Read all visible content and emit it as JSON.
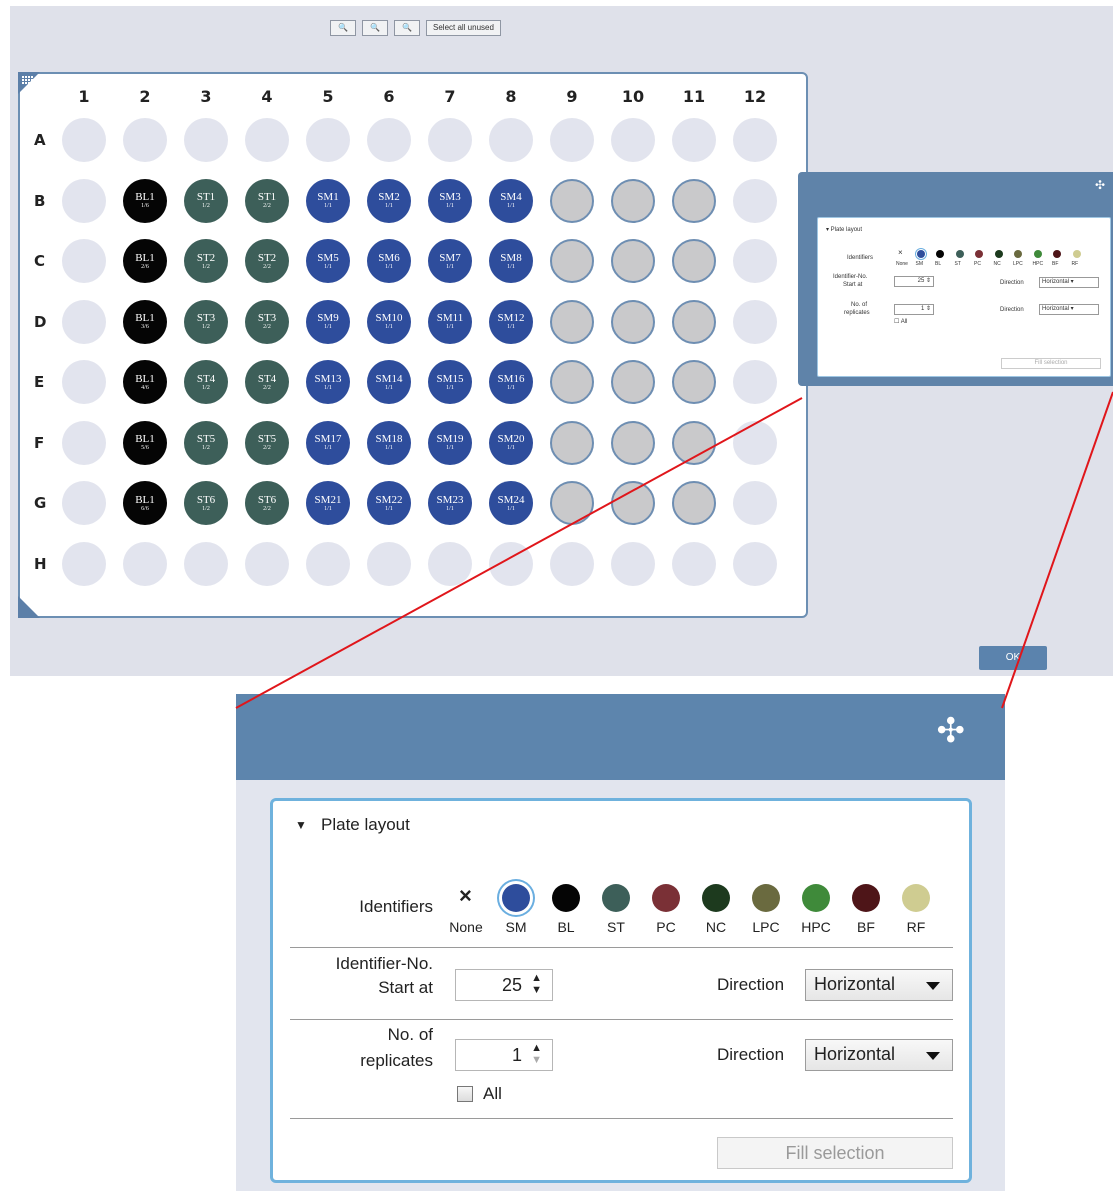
{
  "toolbar": {
    "zoom_in": "🔍",
    "zoom_reset": "🔍",
    "zoom_out": "🔍",
    "select_all_unused": "Select all unused"
  },
  "plate": {
    "icon": "grid-icon",
    "columns": [
      "1",
      "2",
      "3",
      "4",
      "5",
      "6",
      "7",
      "8",
      "9",
      "10",
      "11",
      "12"
    ],
    "rows": [
      "A",
      "B",
      "C",
      "D",
      "E",
      "F",
      "G",
      "H"
    ],
    "filled_wells": {
      "B": [
        [
          "bl",
          "BL1",
          "1/6"
        ],
        [
          "st",
          "ST1",
          "1/2"
        ],
        [
          "st",
          "ST1",
          "2/2"
        ],
        [
          "sm",
          "SM1",
          "1/1"
        ],
        [
          "sm",
          "SM2",
          "1/1"
        ],
        [
          "sm",
          "SM3",
          "1/1"
        ],
        [
          "sm",
          "SM4",
          "1/1"
        ]
      ],
      "C": [
        [
          "bl",
          "BL1",
          "2/6"
        ],
        [
          "st",
          "ST2",
          "1/2"
        ],
        [
          "st",
          "ST2",
          "2/2"
        ],
        [
          "sm",
          "SM5",
          "1/1"
        ],
        [
          "sm",
          "SM6",
          "1/1"
        ],
        [
          "sm",
          "SM7",
          "1/1"
        ],
        [
          "sm",
          "SM8",
          "1/1"
        ]
      ],
      "D": [
        [
          "bl",
          "BL1",
          "3/6"
        ],
        [
          "st",
          "ST3",
          "1/2"
        ],
        [
          "st",
          "ST3",
          "2/2"
        ],
        [
          "sm",
          "SM9",
          "1/1"
        ],
        [
          "sm",
          "SM10",
          "1/1"
        ],
        [
          "sm",
          "SM11",
          "1/1"
        ],
        [
          "sm",
          "SM12",
          "1/1"
        ]
      ],
      "E": [
        [
          "bl",
          "BL1",
          "4/6"
        ],
        [
          "st",
          "ST4",
          "1/2"
        ],
        [
          "st",
          "ST4",
          "2/2"
        ],
        [
          "sm",
          "SM13",
          "1/1"
        ],
        [
          "sm",
          "SM14",
          "1/1"
        ],
        [
          "sm",
          "SM15",
          "1/1"
        ],
        [
          "sm",
          "SM16",
          "1/1"
        ]
      ],
      "F": [
        [
          "bl",
          "BL1",
          "5/6"
        ],
        [
          "st",
          "ST5",
          "1/2"
        ],
        [
          "st",
          "ST5",
          "2/2"
        ],
        [
          "sm",
          "SM17",
          "1/1"
        ],
        [
          "sm",
          "SM18",
          "1/1"
        ],
        [
          "sm",
          "SM19",
          "1/1"
        ],
        [
          "sm",
          "SM20",
          "1/1"
        ]
      ],
      "G": [
        [
          "bl",
          "BL1",
          "6/6"
        ],
        [
          "st",
          "ST6",
          "1/2"
        ],
        [
          "st",
          "ST6",
          "2/2"
        ],
        [
          "sm",
          "SM21",
          "1/1"
        ],
        [
          "sm",
          "SM22",
          "1/1"
        ],
        [
          "sm",
          "SM23",
          "1/1"
        ],
        [
          "sm",
          "SM24",
          "1/1"
        ]
      ]
    },
    "selected_rows": [
      "B",
      "C",
      "D",
      "E",
      "F",
      "G"
    ],
    "selected_cols": [
      "9",
      "10",
      "11"
    ]
  },
  "ok_button": "OK",
  "panel": {
    "move_icon": "move-arrows-icon",
    "section_title": "Plate layout",
    "identifiers_label": "Identifiers",
    "identifiers": [
      {
        "key": "None",
        "color": "none"
      },
      {
        "key": "SM",
        "color": "#2e4d9c"
      },
      {
        "key": "BL",
        "color": "#050505"
      },
      {
        "key": "ST",
        "color": "#3d5f59"
      },
      {
        "key": "PC",
        "color": "#7a3036"
      },
      {
        "key": "NC",
        "color": "#1d3a1e"
      },
      {
        "key": "LPC",
        "color": "#6a6a3f"
      },
      {
        "key": "HPC",
        "color": "#3f8a3a"
      },
      {
        "key": "BF",
        "color": "#4e1518"
      },
      {
        "key": "RF",
        "color": "#cfcc91"
      }
    ],
    "selected_identifier": "SM",
    "start_label_1": "Identifier-No.",
    "start_label_2": "Start at",
    "start_value": "25",
    "direction_label": "Direction",
    "direction_value_1": "Horizontal",
    "replicates_label_1": "No. of",
    "replicates_label_2": "replicates",
    "replicates_value": "1",
    "direction_value_2": "Horizontal",
    "all_label": "All",
    "fill_button": "Fill selection"
  }
}
